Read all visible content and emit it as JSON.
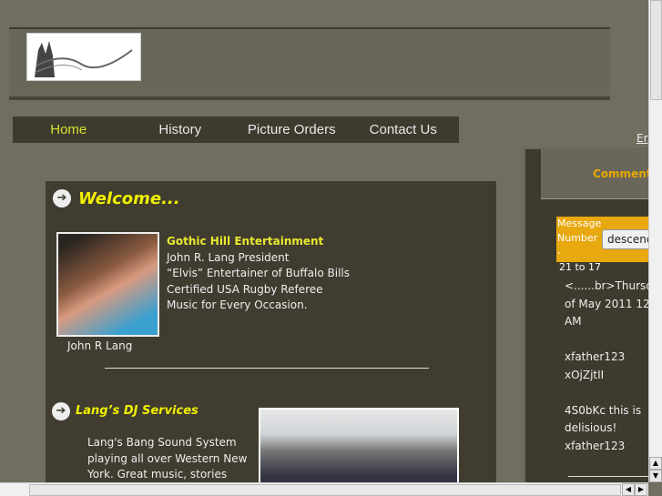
{
  "nav": [
    "Home",
    "History",
    "Picture Orders",
    "Contact Us"
  ],
  "header_link": "Er",
  "welcome": {
    "title": "Welcome...",
    "photo_caption": "John R Lang",
    "company": "Gothic Hill Entertainment",
    "lines": [
      "John R. Lang President",
      "“Elvis” Entertainer of Buffalo Bills",
      "Certified USA Rugby Referee",
      "Music for Every Occasion."
    ]
  },
  "dj": {
    "title": "Lang’s DJ Services",
    "text": "Lang's Bang Sound System playing all over Western New York. Great music, stories"
  },
  "comments": {
    "title": "Comments",
    "msg_label": "Message Number -",
    "range": "21 to 17",
    "sort": "descending",
    "messages": [
      "<......br>Thursday",
      "of May 2011 12",
      "AM",
      "",
      "xfather123",
      "xOjZjtII",
      "",
      "4S0bKc this is",
      "delisious!",
      "xfather123"
    ]
  }
}
